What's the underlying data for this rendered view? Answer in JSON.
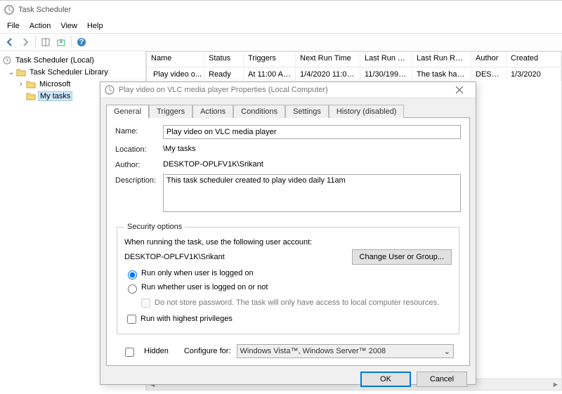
{
  "app": {
    "title": "Task Scheduler"
  },
  "menu": {
    "file": "File",
    "action": "Action",
    "view": "View",
    "help": "Help"
  },
  "tree": {
    "root": "Task Scheduler (Local)",
    "library": "Task Scheduler Library",
    "microsoft": "Microsoft",
    "mytasks": "My tasks"
  },
  "grid": {
    "headers": {
      "name": "Name",
      "status": "Status",
      "triggers": "Triggers",
      "next_run": "Next Run Time",
      "last_run": "Last Run Time",
      "last_result": "Last Run Result",
      "author": "Author",
      "created": "Created"
    },
    "row": {
      "name": "Play video o...",
      "status": "Ready",
      "triggers": "At 11:00 AM ...",
      "next_run": "1/4/2020 11:00:0...",
      "last_run": "11/30/1999 ...",
      "last_result": "The task has ...",
      "author": "DESK...",
      "created": "1/3/2020"
    }
  },
  "dialog": {
    "title": "Play video on VLC media player Properties (Local Computer)",
    "tabs": {
      "general": "General",
      "triggers": "Triggers",
      "actions": "Actions",
      "conditions": "Conditions",
      "settings": "Settings",
      "history": "History (disabled)"
    },
    "labels": {
      "name": "Name:",
      "location": "Location:",
      "author": "Author:",
      "description": "Description:",
      "security": "Security options",
      "when_running": "When running the task, use the following user account:",
      "change_user": "Change User or Group...",
      "run_logged_on": "Run only when user is logged on",
      "run_whether": "Run whether user is logged on or not",
      "do_not_store": "Do not store password.  The task will only have access to local computer resources.",
      "run_highest": "Run with highest privileges",
      "hidden": "Hidden",
      "configure_for": "Configure for:"
    },
    "values": {
      "name": "Play video on VLC media player",
      "location": "\\My tasks",
      "author": "DESKTOP-OPLFV1K\\Srikant",
      "description": "This task scheduler created to play video daily 11am",
      "user_account": "DESKTOP-OPLFV1K\\Srikant",
      "configure_for": "Windows Vista™, Windows Server™ 2008"
    },
    "buttons": {
      "ok": "OK",
      "cancel": "Cancel"
    }
  },
  "ghost": {
    "run_whether": "Run whether user is logged on or not",
    "do_not_store": "Do not store password.  The task will only have access to local resources",
    "partial": "R"
  }
}
